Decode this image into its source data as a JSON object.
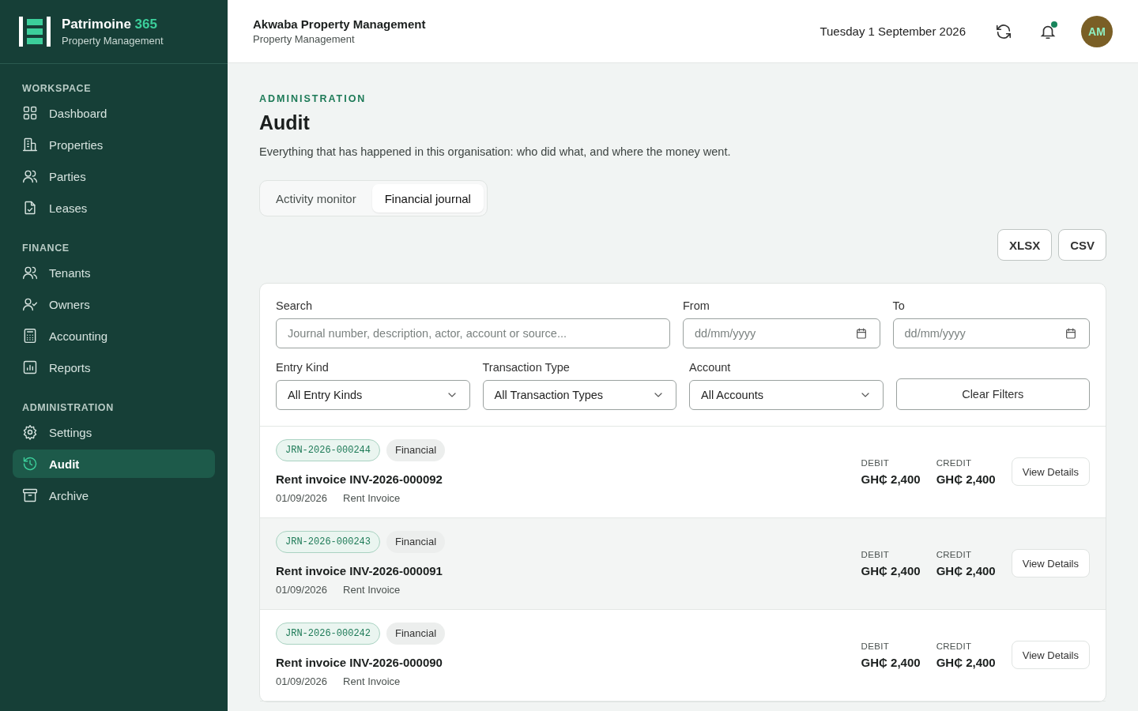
{
  "brand": {
    "name": "Patrimoine",
    "accent": "365",
    "subtitle": "Property Management"
  },
  "sidebar": {
    "sections": [
      {
        "title": "WORKSPACE",
        "items": [
          {
            "label": "Dashboard",
            "selected": false
          },
          {
            "label": "Properties",
            "selected": false
          },
          {
            "label": "Parties",
            "selected": false
          },
          {
            "label": "Leases",
            "selected": false
          }
        ]
      },
      {
        "title": "FINANCE",
        "items": [
          {
            "label": "Tenants",
            "selected": false
          },
          {
            "label": "Owners",
            "selected": false
          },
          {
            "label": "Accounting",
            "selected": false
          },
          {
            "label": "Reports",
            "selected": false
          }
        ]
      },
      {
        "title": "ADMINISTRATION",
        "items": [
          {
            "label": "Settings",
            "selected": false
          },
          {
            "label": "Audit",
            "selected": true
          },
          {
            "label": "Archive",
            "selected": false
          }
        ]
      }
    ]
  },
  "header": {
    "org": "Akwaba Property Management",
    "org_subtitle": "Property Management",
    "date": "Tuesday 1 September 2026",
    "notification": true,
    "avatar": "AM"
  },
  "page": {
    "eyebrow": "ADMINISTRATION",
    "title": "Audit",
    "description": "Everything that has happened in this organisation: who did what, and where the money went."
  },
  "tabs": [
    {
      "label": "Activity monitor",
      "selected": false
    },
    {
      "label": "Financial journal",
      "selected": true
    }
  ],
  "export_buttons": [
    "XLSX",
    "CSV"
  ],
  "filters": {
    "search": {
      "label": "Search",
      "placeholder": "Journal number, description, actor, account or source..."
    },
    "from": {
      "label": "From",
      "placeholder": "dd/mm/yyyy"
    },
    "to": {
      "label": "To",
      "placeholder": "dd/mm/yyyy"
    },
    "entry_kind": {
      "label": "Entry Kind",
      "value": "All Entry Kinds"
    },
    "transaction_type": {
      "label": "Transaction Type",
      "value": "All Transaction Types"
    },
    "account": {
      "label": "Account",
      "value": "All Accounts"
    },
    "clear": "Clear Filters"
  },
  "entries": [
    {
      "number": "JRN-2026-000244",
      "kind": "Financial",
      "title": "Rent invoice INV-2026-000092",
      "date": "01/09/2026",
      "source": "Rent Invoice",
      "debit_label": "DEBIT",
      "debit": "GH₵ 2,400",
      "credit_label": "CREDIT",
      "credit": "GH₵ 2,400",
      "action": "View Details"
    },
    {
      "number": "JRN-2026-000243",
      "kind": "Financial",
      "title": "Rent invoice INV-2026-000091",
      "date": "01/09/2026",
      "source": "Rent Invoice",
      "debit_label": "DEBIT",
      "debit": "GH₵ 2,400",
      "credit_label": "CREDIT",
      "credit": "GH₵ 2,400",
      "action": "View Details"
    },
    {
      "number": "JRN-2026-000242",
      "kind": "Financial",
      "title": "Rent invoice INV-2026-000090",
      "date": "01/09/2026",
      "source": "Rent Invoice",
      "debit_label": "DEBIT",
      "debit": "GH₵ 2,400",
      "credit_label": "CREDIT",
      "credit": "GH₵ 2,400",
      "action": "View Details"
    }
  ]
}
